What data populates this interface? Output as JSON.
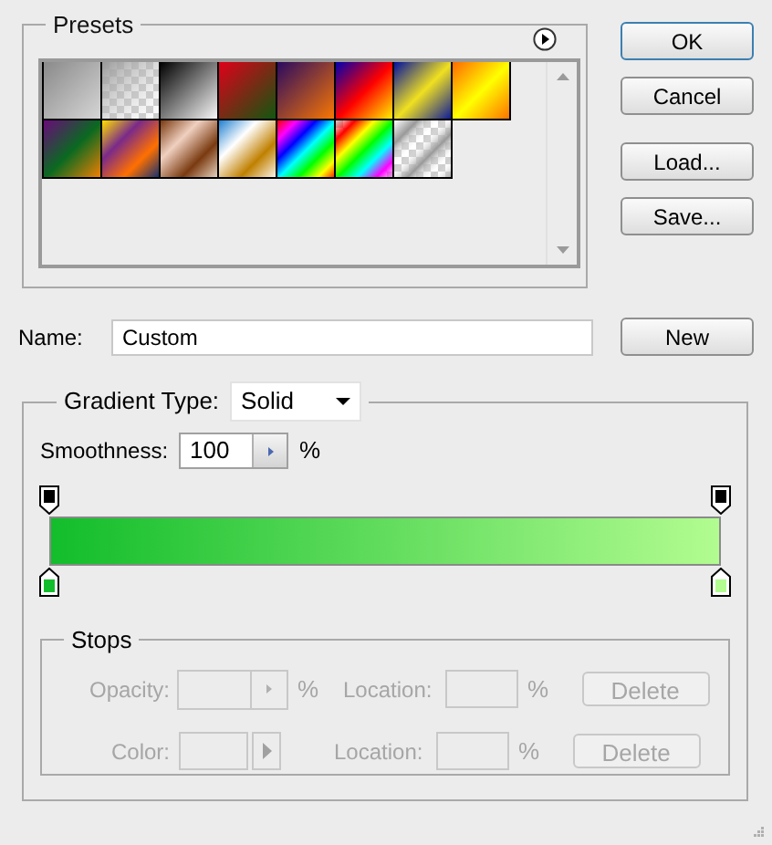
{
  "presets": {
    "legend": "Presets"
  },
  "buttons": [
    {
      "label": "OK",
      "default": true
    },
    {
      "label": "Cancel",
      "default": false
    },
    {
      "label": "Load...",
      "default": false
    },
    {
      "label": "Save...",
      "default": false
    }
  ],
  "name": {
    "label": "Name:",
    "value": "Custom"
  },
  "new_button": {
    "label": "New"
  },
  "gradient_type": {
    "label": "Gradient Type:",
    "value": "Solid"
  },
  "smoothness": {
    "label": "Smoothness:",
    "value": "100",
    "unit": "%"
  },
  "opacity_stops": [
    {
      "color": "#000000"
    },
    {
      "color": "#000000"
    }
  ],
  "color_stops": [
    {
      "color": "#12bd2b"
    },
    {
      "color": "#b2fc90"
    }
  ],
  "stops": {
    "legend": "Stops",
    "rows": [
      {
        "kind": "opacity",
        "label": "Opacity:",
        "unit": "%",
        "location_label": "Location:",
        "location_unit": "%",
        "button": "Delete",
        "disabled": true
      },
      {
        "kind": "color",
        "label": "Color:",
        "location_label": "Location:",
        "location_unit": "%",
        "button": "Delete",
        "disabled": true
      }
    ]
  }
}
